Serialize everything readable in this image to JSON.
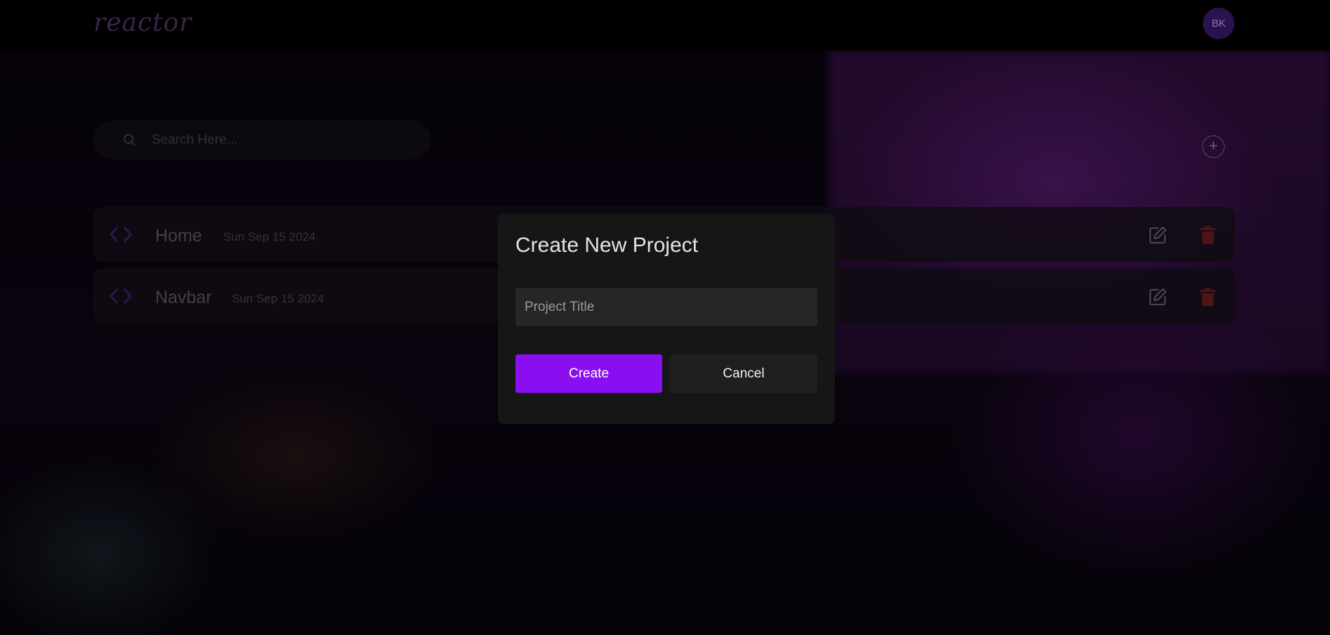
{
  "app": {
    "logo_text": "reactor",
    "avatar_initials": "BK"
  },
  "search": {
    "placeholder": "Search Here..."
  },
  "add_button": {
    "symbol": "+"
  },
  "projects": [
    {
      "name": "Home",
      "date": "Sun Sep 15 2024"
    },
    {
      "name": "Navbar",
      "date": "Sun Sep 15 2024"
    }
  ],
  "modal": {
    "title": "Create New Project",
    "input_placeholder": "Project Title",
    "input_value": "",
    "create_label": "Create",
    "cancel_label": "Cancel"
  },
  "colors": {
    "accent": "#8a0ff0",
    "modal_bg": "#161616",
    "delete": "#7a1f1f"
  },
  "icons": {
    "search": "search-icon",
    "add": "plus-circle-icon",
    "code": "code-icon",
    "edit": "edit-icon",
    "delete": "trash-icon"
  }
}
